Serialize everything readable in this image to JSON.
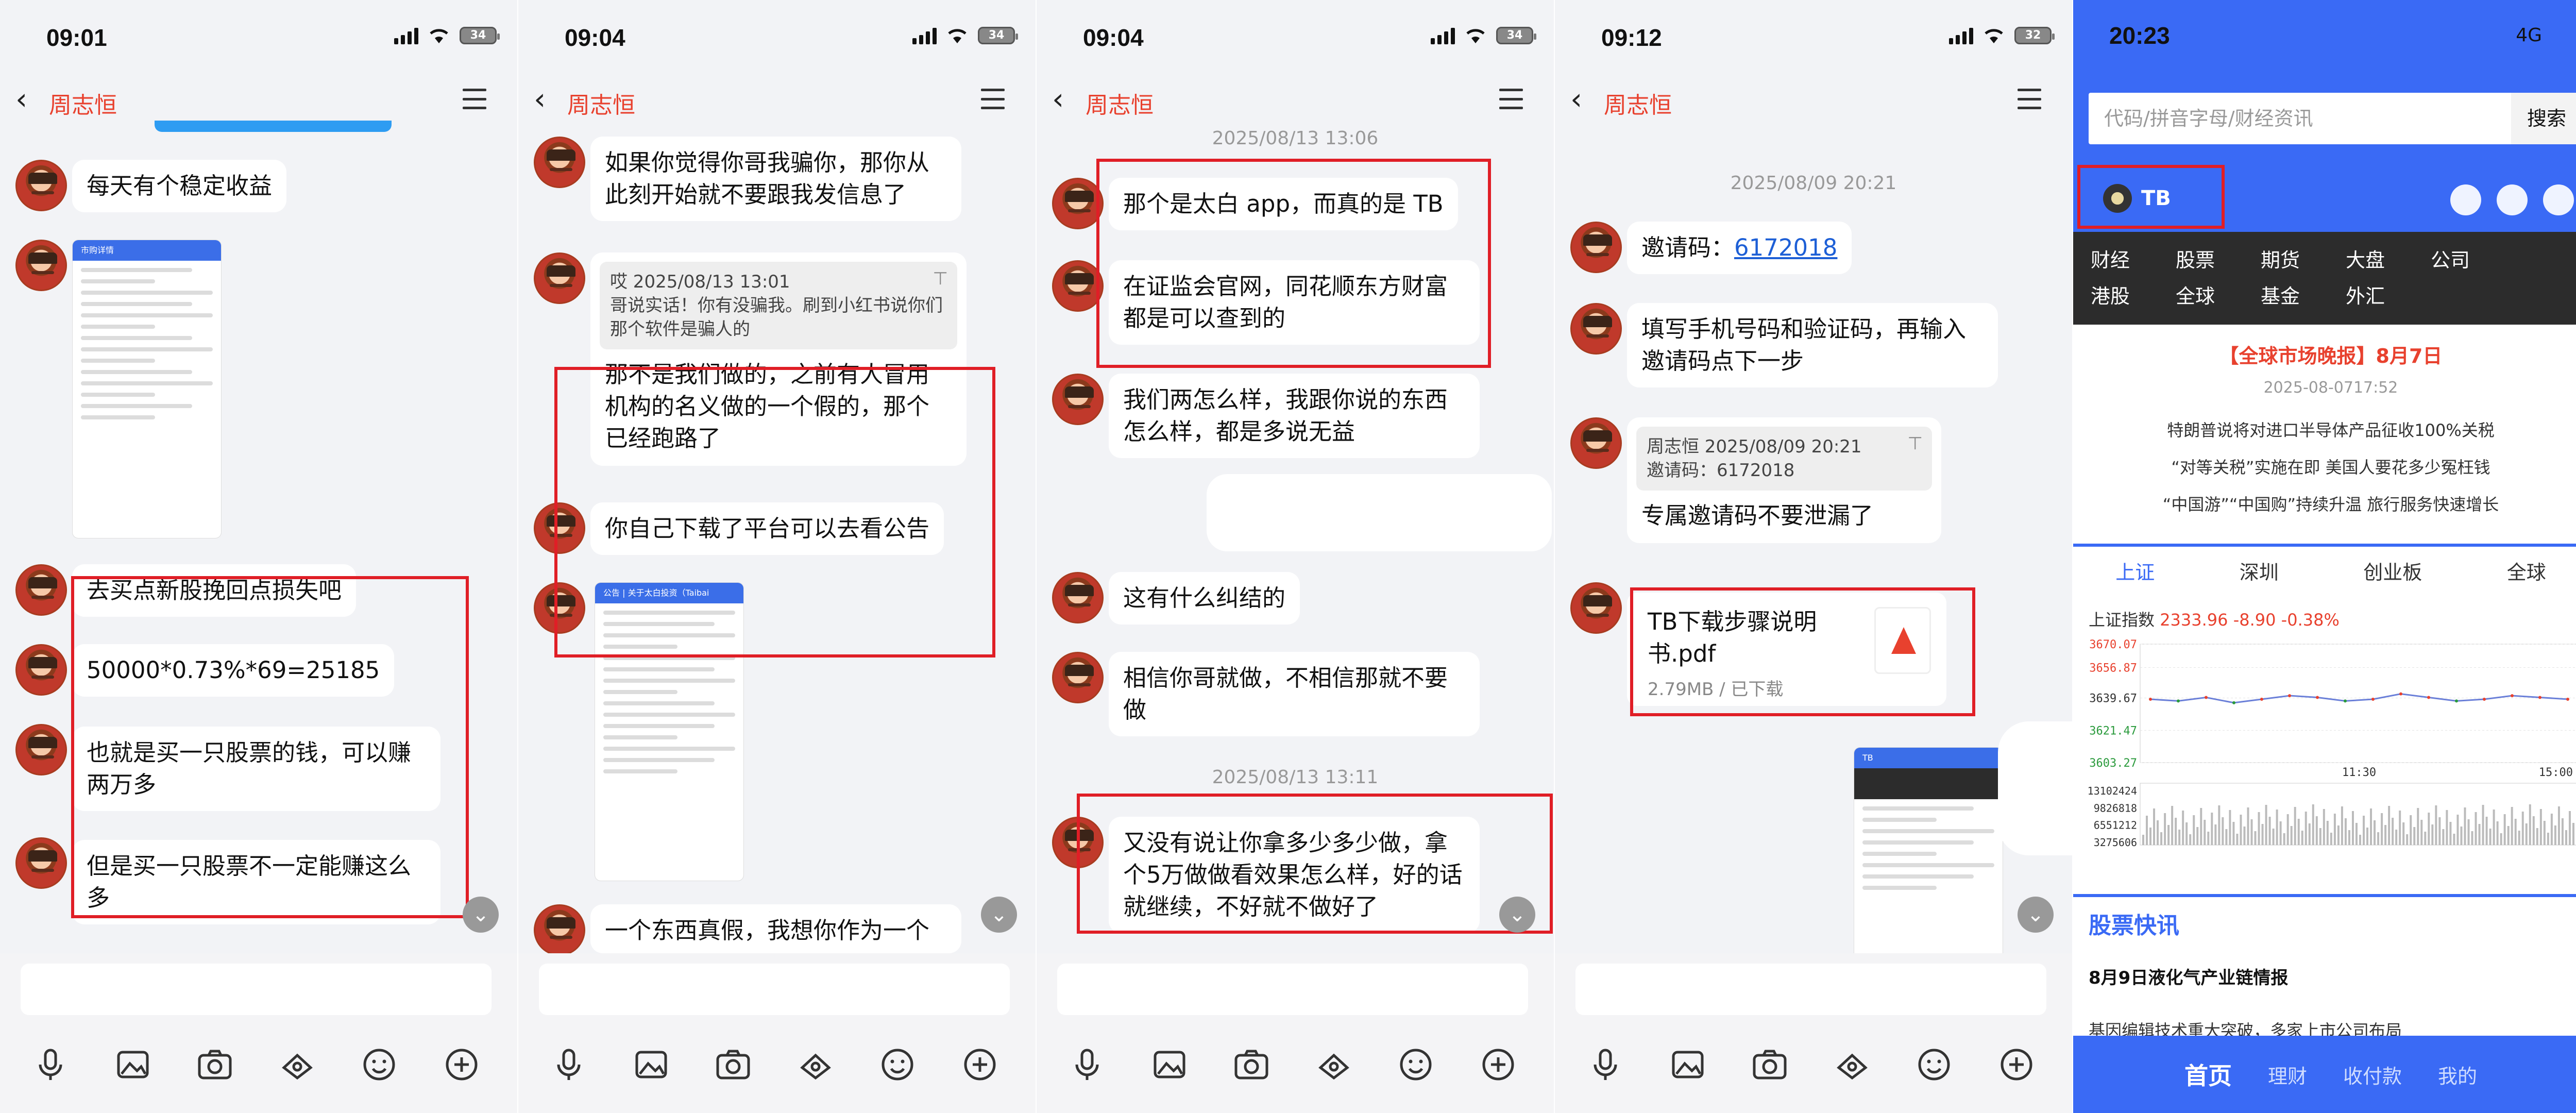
{
  "chat_panels": [
    {
      "time": "09:01",
      "battery": "34",
      "contact": "周志恒",
      "messages": [
        "每天有个稳定收益",
        "去买点新股挽回点损失吧",
        "50000*0.73%*69=25185",
        "也就是买一只股票的钱，可以赚两万多",
        "但是买一只股票不一定能赚这么多"
      ]
    },
    {
      "time": "09:04",
      "battery": "34",
      "contact": "周志恒",
      "messages": [
        "如果你觉得你哥我骗你，那你从此刻开始就不要跟我发信息了",
        "那不是我们做的，之前有人冒用机构的名义做的一个假的，那个已经跑路了",
        "你自己下载了平台可以去看公告",
        "一个东西真假，我想你作为一个"
      ],
      "quote": {
        "header": "哎 2025/08/13 13:01",
        "body": "哥说实话！你有没骗我。刷到小红书说你们那个软件是骗人的"
      },
      "doc_title": "公告 | 关于太白投资（Taibai"
    },
    {
      "time": "09:04",
      "battery": "34",
      "contact": "周志恒",
      "timestamps": [
        "2025/08/13 13:06",
        "2025/08/13 13:11"
      ],
      "messages": [
        "那个是太白 app，而真的是 TB",
        "在证监会官网，同花顺东方财富都是可以查到的",
        "我们两怎么样，我跟你说的东西怎么样，都是多说无益",
        "这有什么纠结的",
        "相信你哥就做，不相信那就不要做",
        "又没有说让你拿多少多少做，拿个5万做做看效果怎么样，好的话就继续，不好就不做好了"
      ]
    },
    {
      "time": "09:12",
      "battery": "32",
      "contact": "周志恒",
      "timestamps": [
        "2025/08/09 20:21"
      ],
      "invite_label": "邀请码：",
      "invite_code": "6172018",
      "messages": [
        "填写手机号码和验证码，再输入邀请码点下一步",
        "专属邀请码不要泄漏了"
      ],
      "quote": {
        "header": "周志恒 2025/08/09 20:21",
        "body": "邀请码：6172018"
      },
      "file": {
        "name": "TB下载步骤说明书.pdf",
        "meta": "2.79MB / 已下载"
      }
    }
  ],
  "finance_app": {
    "time": "20:23",
    "network": "4G",
    "search_placeholder": "代码/拼音字母/财经资讯",
    "search_button": "搜索",
    "logo_text": "TB",
    "menu": [
      "财经",
      "股票",
      "期货",
      "大盘",
      "公司",
      "港股",
      "全球",
      "基金",
      "外汇"
    ],
    "headline": "【全球市场晚报】8月7日",
    "headline_date": "2025-08-0717:52",
    "news": [
      "特朗普说将对进口半导体产品征收100%关税",
      "“对等关税”实施在即 美国人要花多少冤枉钱",
      "“中国游”“中国购”持续升温 旅行服务快速增长"
    ],
    "tabs": [
      "上证",
      "深圳",
      "创业板",
      "全球"
    ],
    "index_label": "上证指数",
    "index_value": "2333.96 -8.90 -0.38%",
    "section_title": "股票快讯",
    "flash_news": [
      "8月9日液化气产业链情报",
      "基因编辑技术重大突破，多家上市公司布局"
    ],
    "bottom_nav": [
      "首页",
      "理财",
      "收付款",
      "我的"
    ],
    "accent_color": "#3a6af5",
    "chart_data": {
      "type": "line",
      "title": "",
      "y_ticks": [
        "3670.07",
        "3656.87",
        "3639.67",
        "3621.47",
        "3603.27"
      ],
      "volume_ticks": [
        "13102424",
        "9826818",
        "6551212",
        "3275606"
      ],
      "x_ticks": [
        "11:30",
        "15:00"
      ],
      "series": [
        {
          "values": [
            3639,
            3638,
            3640,
            3637,
            3639,
            3641,
            3640,
            3638,
            3639,
            3642,
            3640,
            3638,
            3639,
            3641,
            3640,
            3639
          ]
        }
      ]
    }
  }
}
